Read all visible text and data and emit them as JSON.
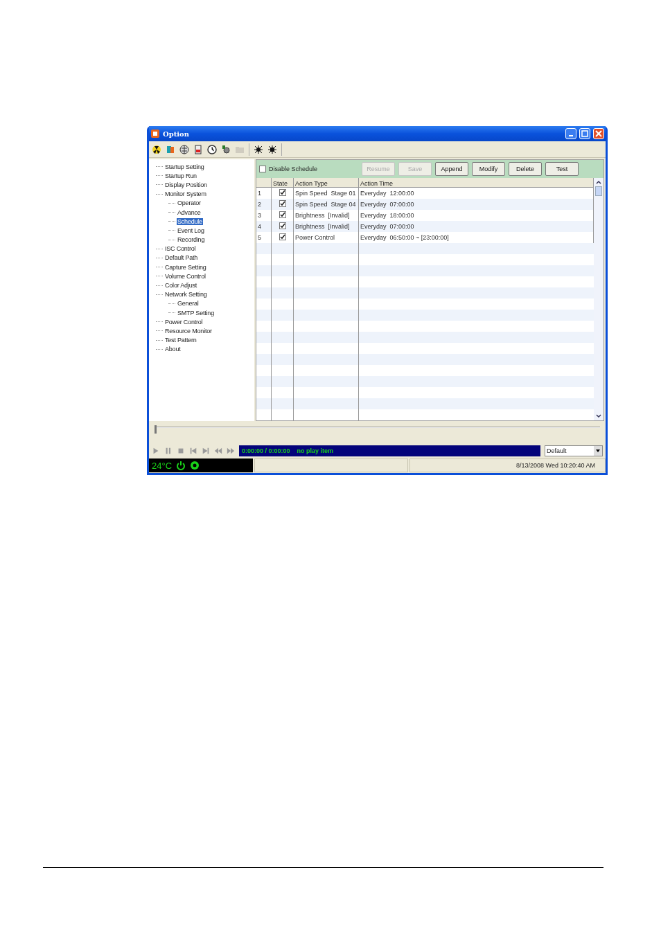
{
  "window": {
    "title": "Option"
  },
  "tree": [
    {
      "label": "Startup Setting",
      "selected": false
    },
    {
      "label": "Startup Run",
      "selected": false
    },
    {
      "label": "Display Position",
      "selected": false
    },
    {
      "label": "Monitor System",
      "selected": false,
      "children": [
        {
          "label": "Operator",
          "selected": false
        },
        {
          "label": "Advance",
          "selected": false
        },
        {
          "label": "Schedule",
          "selected": true
        },
        {
          "label": "Event Log",
          "selected": false
        },
        {
          "label": "Recording",
          "selected": false
        }
      ]
    },
    {
      "label": "ISC Control",
      "selected": false
    },
    {
      "label": "Default Path",
      "selected": false
    },
    {
      "label": "Capture Setting",
      "selected": false
    },
    {
      "label": "Volume Control",
      "selected": false
    },
    {
      "label": "Color Adjust",
      "selected": false
    },
    {
      "label": "Network Setting",
      "selected": false,
      "children": [
        {
          "label": "General",
          "selected": false
        },
        {
          "label": "SMTP Setting",
          "selected": false
        }
      ]
    },
    {
      "label": "Power Control",
      "selected": false
    },
    {
      "label": "Resource Monitor",
      "selected": false
    },
    {
      "label": "Test Pattern",
      "selected": false
    },
    {
      "label": "About",
      "selected": false
    }
  ],
  "disable_schedule": {
    "label": "Disable Schedule",
    "checked": false
  },
  "buttons": [
    {
      "label": "Resume",
      "disabled": true
    },
    {
      "label": "Save",
      "disabled": true
    },
    {
      "label": "Append",
      "disabled": false
    },
    {
      "label": "Modify",
      "disabled": false
    },
    {
      "label": "Delete",
      "disabled": false
    },
    {
      "label": "Test",
      "disabled": false
    }
  ],
  "table": {
    "columns": [
      "State",
      "Action Type",
      "Action Time"
    ],
    "rows": [
      {
        "index": "1",
        "checked": true,
        "action_type": "Spin Speed  Stage 01",
        "action_time": "Everyday  12:00:00"
      },
      {
        "index": "2",
        "checked": true,
        "action_type": "Spin Speed  Stage 04",
        "action_time": "Everyday  07:00:00"
      },
      {
        "index": "3",
        "checked": true,
        "action_type": "Brightness  [Invalid]",
        "action_time": "Everyday  18:00:00"
      },
      {
        "index": "4",
        "checked": true,
        "action_type": "Brightness  [Invalid]",
        "action_time": "Everyday  07:00:00"
      },
      {
        "index": "5",
        "checked": true,
        "action_type": "Power Control",
        "action_time": "Everyday  06:50:00 ~ [23:00:00]"
      }
    ]
  },
  "seek_bar": {
    "level": 0
  },
  "player": {
    "time": "0:00:00 / 0:00:00",
    "status": "no play item",
    "preset": "Default"
  },
  "status_bar": {
    "temperature": "24°C",
    "datetime": "8/13/2008 Wed 10:20:40 AM"
  }
}
